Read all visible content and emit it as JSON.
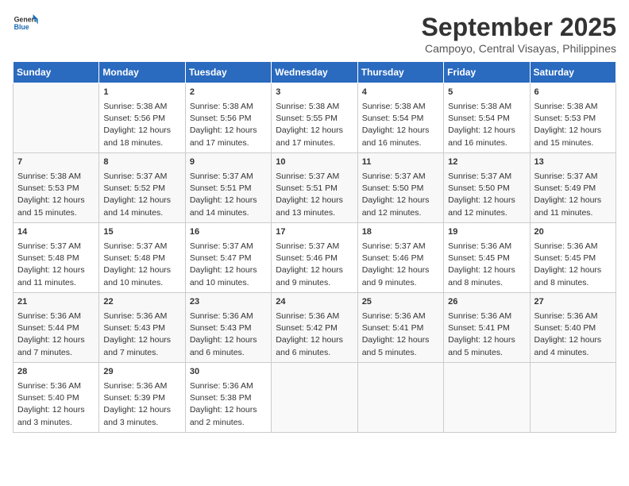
{
  "logo": {
    "line1": "General",
    "line2": "Blue"
  },
  "title": "September 2025",
  "location": "Campoyo, Central Visayas, Philippines",
  "days_of_week": [
    "Sunday",
    "Monday",
    "Tuesday",
    "Wednesday",
    "Thursday",
    "Friday",
    "Saturday"
  ],
  "weeks": [
    [
      {
        "day": "",
        "content": ""
      },
      {
        "day": "1",
        "content": "Sunrise: 5:38 AM\nSunset: 5:56 PM\nDaylight: 12 hours\nand 18 minutes."
      },
      {
        "day": "2",
        "content": "Sunrise: 5:38 AM\nSunset: 5:56 PM\nDaylight: 12 hours\nand 17 minutes."
      },
      {
        "day": "3",
        "content": "Sunrise: 5:38 AM\nSunset: 5:55 PM\nDaylight: 12 hours\nand 17 minutes."
      },
      {
        "day": "4",
        "content": "Sunrise: 5:38 AM\nSunset: 5:54 PM\nDaylight: 12 hours\nand 16 minutes."
      },
      {
        "day": "5",
        "content": "Sunrise: 5:38 AM\nSunset: 5:54 PM\nDaylight: 12 hours\nand 16 minutes."
      },
      {
        "day": "6",
        "content": "Sunrise: 5:38 AM\nSunset: 5:53 PM\nDaylight: 12 hours\nand 15 minutes."
      }
    ],
    [
      {
        "day": "7",
        "content": "Sunrise: 5:38 AM\nSunset: 5:53 PM\nDaylight: 12 hours\nand 15 minutes."
      },
      {
        "day": "8",
        "content": "Sunrise: 5:37 AM\nSunset: 5:52 PM\nDaylight: 12 hours\nand 14 minutes."
      },
      {
        "day": "9",
        "content": "Sunrise: 5:37 AM\nSunset: 5:51 PM\nDaylight: 12 hours\nand 14 minutes."
      },
      {
        "day": "10",
        "content": "Sunrise: 5:37 AM\nSunset: 5:51 PM\nDaylight: 12 hours\nand 13 minutes."
      },
      {
        "day": "11",
        "content": "Sunrise: 5:37 AM\nSunset: 5:50 PM\nDaylight: 12 hours\nand 12 minutes."
      },
      {
        "day": "12",
        "content": "Sunrise: 5:37 AM\nSunset: 5:50 PM\nDaylight: 12 hours\nand 12 minutes."
      },
      {
        "day": "13",
        "content": "Sunrise: 5:37 AM\nSunset: 5:49 PM\nDaylight: 12 hours\nand 11 minutes."
      }
    ],
    [
      {
        "day": "14",
        "content": "Sunrise: 5:37 AM\nSunset: 5:48 PM\nDaylight: 12 hours\nand 11 minutes."
      },
      {
        "day": "15",
        "content": "Sunrise: 5:37 AM\nSunset: 5:48 PM\nDaylight: 12 hours\nand 10 minutes."
      },
      {
        "day": "16",
        "content": "Sunrise: 5:37 AM\nSunset: 5:47 PM\nDaylight: 12 hours\nand 10 minutes."
      },
      {
        "day": "17",
        "content": "Sunrise: 5:37 AM\nSunset: 5:46 PM\nDaylight: 12 hours\nand 9 minutes."
      },
      {
        "day": "18",
        "content": "Sunrise: 5:37 AM\nSunset: 5:46 PM\nDaylight: 12 hours\nand 9 minutes."
      },
      {
        "day": "19",
        "content": "Sunrise: 5:36 AM\nSunset: 5:45 PM\nDaylight: 12 hours\nand 8 minutes."
      },
      {
        "day": "20",
        "content": "Sunrise: 5:36 AM\nSunset: 5:45 PM\nDaylight: 12 hours\nand 8 minutes."
      }
    ],
    [
      {
        "day": "21",
        "content": "Sunrise: 5:36 AM\nSunset: 5:44 PM\nDaylight: 12 hours\nand 7 minutes."
      },
      {
        "day": "22",
        "content": "Sunrise: 5:36 AM\nSunset: 5:43 PM\nDaylight: 12 hours\nand 7 minutes."
      },
      {
        "day": "23",
        "content": "Sunrise: 5:36 AM\nSunset: 5:43 PM\nDaylight: 12 hours\nand 6 minutes."
      },
      {
        "day": "24",
        "content": "Sunrise: 5:36 AM\nSunset: 5:42 PM\nDaylight: 12 hours\nand 6 minutes."
      },
      {
        "day": "25",
        "content": "Sunrise: 5:36 AM\nSunset: 5:41 PM\nDaylight: 12 hours\nand 5 minutes."
      },
      {
        "day": "26",
        "content": "Sunrise: 5:36 AM\nSunset: 5:41 PM\nDaylight: 12 hours\nand 5 minutes."
      },
      {
        "day": "27",
        "content": "Sunrise: 5:36 AM\nSunset: 5:40 PM\nDaylight: 12 hours\nand 4 minutes."
      }
    ],
    [
      {
        "day": "28",
        "content": "Sunrise: 5:36 AM\nSunset: 5:40 PM\nDaylight: 12 hours\nand 3 minutes."
      },
      {
        "day": "29",
        "content": "Sunrise: 5:36 AM\nSunset: 5:39 PM\nDaylight: 12 hours\nand 3 minutes."
      },
      {
        "day": "30",
        "content": "Sunrise: 5:36 AM\nSunset: 5:38 PM\nDaylight: 12 hours\nand 2 minutes."
      },
      {
        "day": "",
        "content": ""
      },
      {
        "day": "",
        "content": ""
      },
      {
        "day": "",
        "content": ""
      },
      {
        "day": "",
        "content": ""
      }
    ]
  ]
}
